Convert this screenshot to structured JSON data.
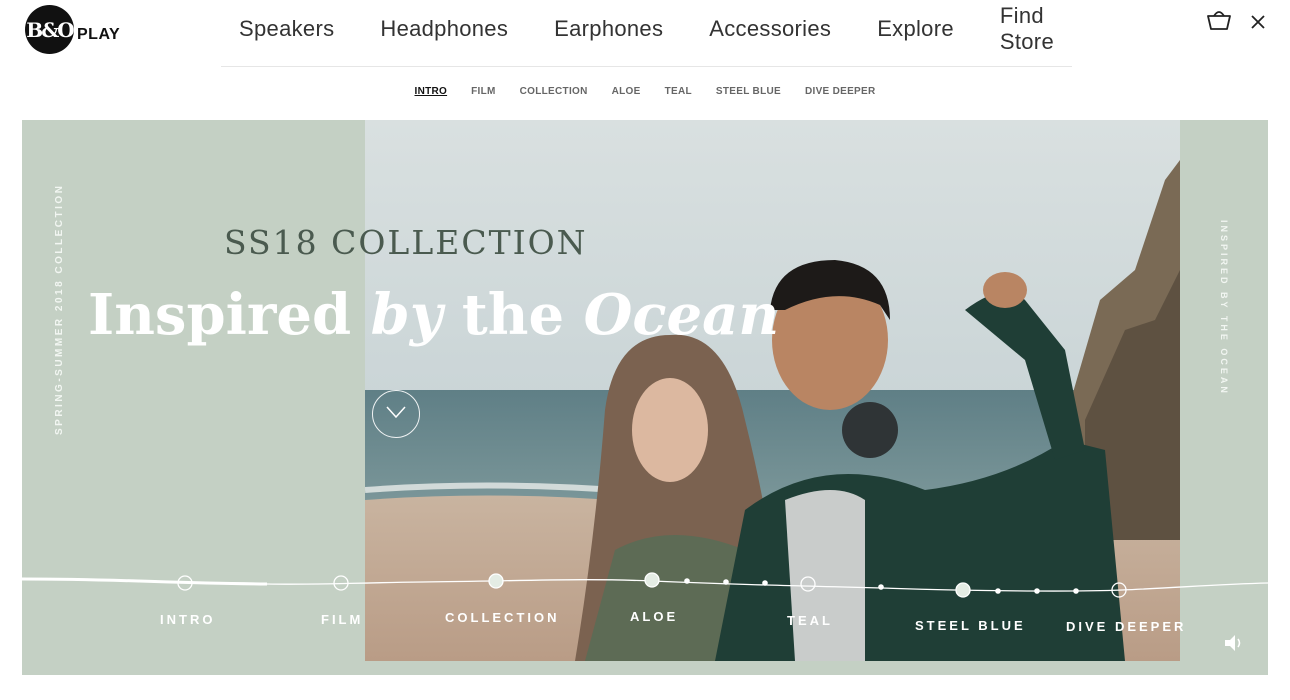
{
  "brand": {
    "mark": "B&O",
    "name": "PLAY"
  },
  "main_nav": [
    "Speakers",
    "Headphones",
    "Earphones",
    "Accessories",
    "Explore",
    "Find Store"
  ],
  "header_icons": {
    "basket": "basket-icon",
    "close": "close-icon"
  },
  "sub_nav": {
    "items": [
      "INTRO",
      "FILM",
      "COLLECTION",
      "ALOE",
      "TEAL",
      "STEEL BLUE",
      "DIVE DEEPER"
    ],
    "active": "INTRO"
  },
  "hero": {
    "side_left": "SPRING-SUMMER 2018 COLLECTION",
    "side_right": "INSPIRED BY THE OCEAN",
    "collection_title": "SS18 COLLECTION",
    "headline": {
      "w1": "Inspired",
      "w2": "by",
      "w3": "the",
      "w4": "Ocean"
    },
    "scroll_icon": "chevron-down-icon"
  },
  "timeline": {
    "labels": [
      "INTRO",
      "FILM",
      "COLLECTION",
      "ALOE",
      "TEAL",
      "STEEL BLUE",
      "DIVE DEEPER"
    ],
    "active": "INTRO"
  },
  "sound_icon": "sound-icon",
  "colors": {
    "hero_bg": "#c4d0c4",
    "title": "#4a5a4f",
    "text_light": "#ffffff"
  }
}
